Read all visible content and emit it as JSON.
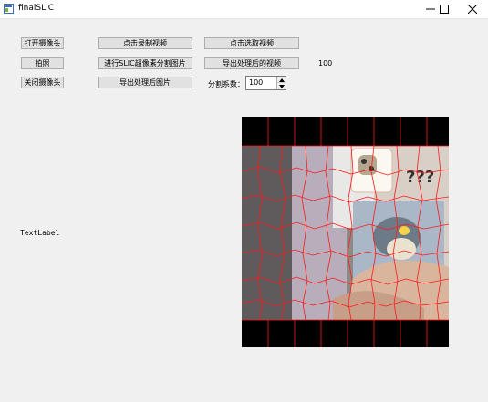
{
  "window": {
    "title": "finalSLIC",
    "icons": [
      "app-icon",
      "minimize-icon",
      "maximize-icon",
      "close-icon"
    ]
  },
  "buttons": {
    "open_camera": "打开摄像头",
    "take_photo": "拍照",
    "close_camera": "关闭摄像头",
    "record_video": "点击录制视频",
    "slic_segment_image": "进行SLIC超像素分割图片",
    "export_processed_image": "导出处理后图片",
    "select_video": "点击选取视频",
    "export_processed_video": "导出处理后的视频"
  },
  "slider_value_label": "100",
  "segmentation": {
    "label": "分割系数：",
    "value": "100"
  },
  "text_label": "TextLabel",
  "preview": {
    "description_icon": "camera-preview-image"
  },
  "colors": {
    "background": "#f0f0f0",
    "button": "#e1e1e1",
    "segment_lines": "#ff1a1a"
  }
}
